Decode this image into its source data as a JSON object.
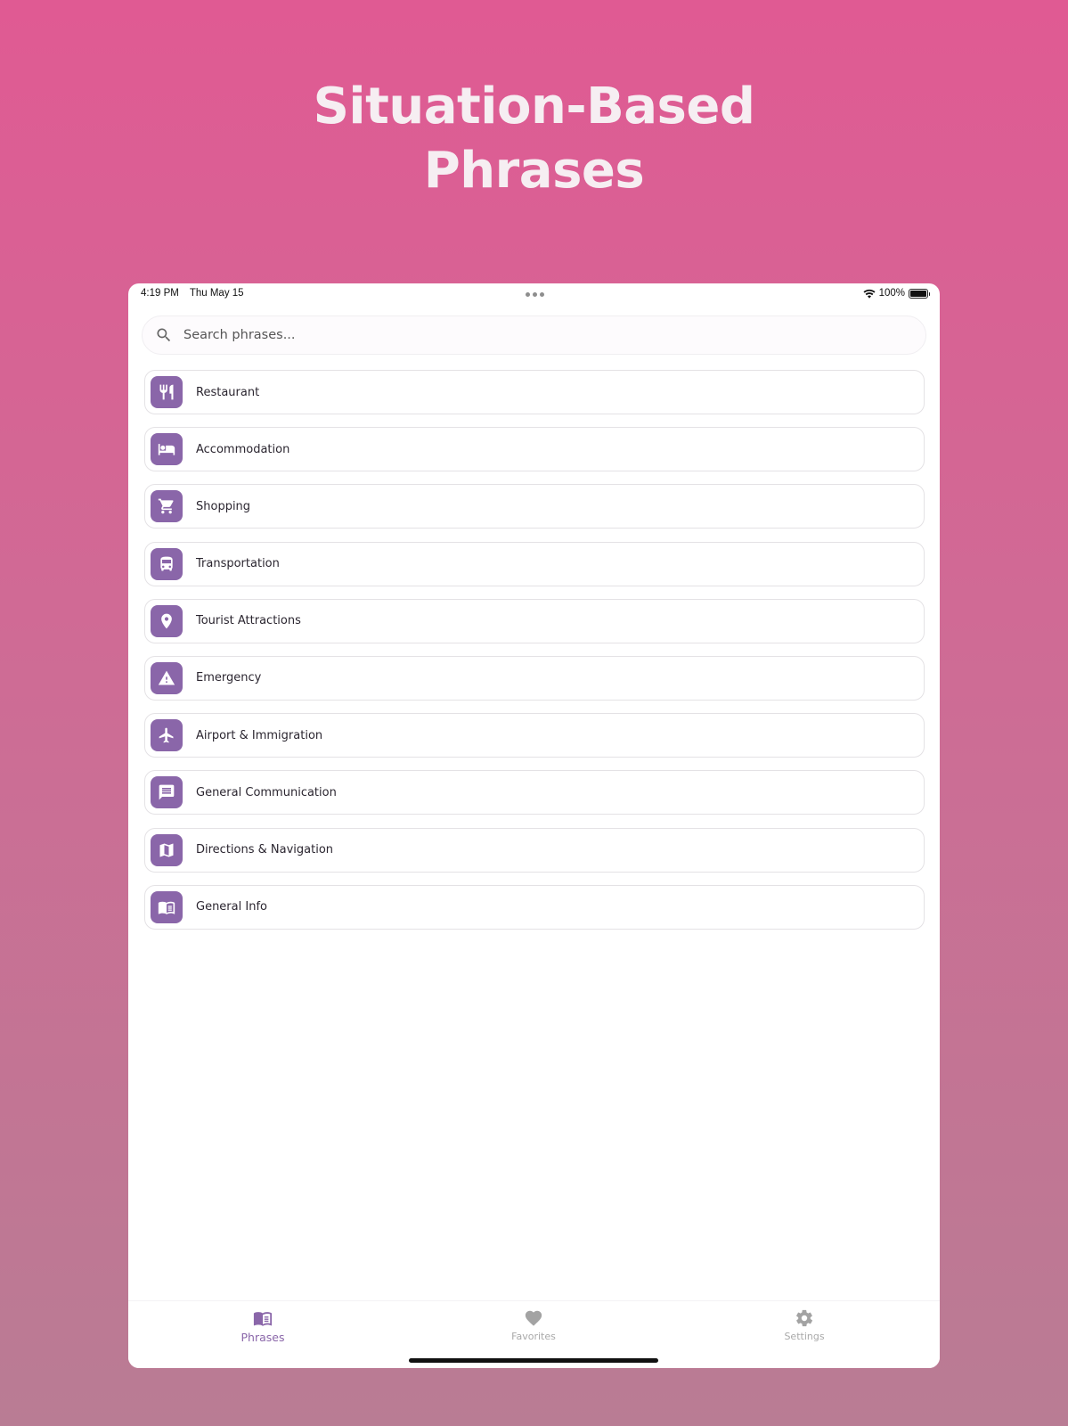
{
  "headline": {
    "line1": "Situation-Based",
    "line2": "Phrases"
  },
  "status_bar": {
    "time": "4:19 PM",
    "date": "Thu May 15",
    "battery": "100%"
  },
  "search": {
    "placeholder": "Search phrases..."
  },
  "categories": [
    {
      "label": "Restaurant",
      "icon": "restaurant-icon"
    },
    {
      "label": "Accommodation",
      "icon": "bed-icon"
    },
    {
      "label": "Shopping",
      "icon": "cart-icon"
    },
    {
      "label": "Transportation",
      "icon": "bus-icon"
    },
    {
      "label": "Tourist Attractions",
      "icon": "location-pin-icon"
    },
    {
      "label": "Emergency",
      "icon": "warning-icon"
    },
    {
      "label": "Airport & Immigration",
      "icon": "airplane-icon"
    },
    {
      "label": "General Communication",
      "icon": "chat-icon"
    },
    {
      "label": "Directions & Navigation",
      "icon": "map-icon"
    },
    {
      "label": "General Info",
      "icon": "book-icon"
    }
  ],
  "tabs": {
    "phrases": "Phrases",
    "favorites": "Favorites",
    "settings": "Settings"
  },
  "colors": {
    "accent": "#8a66a9",
    "background_top": "#e05a93",
    "background_bottom": "#b97c94",
    "inactive_tab": "#a9a9a9"
  }
}
